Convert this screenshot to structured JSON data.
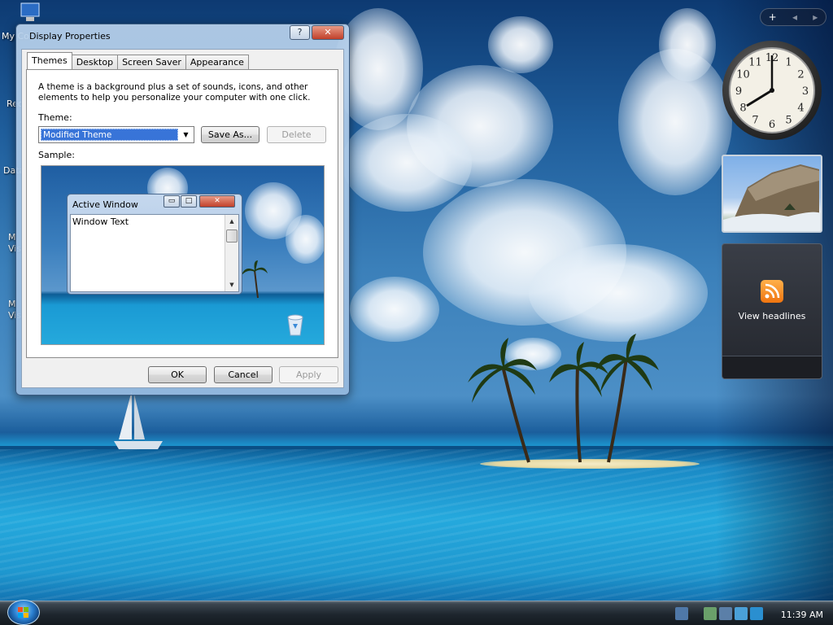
{
  "desktop": {
    "icons": [
      {
        "label": "My Co",
        "icon": "computer-icon"
      },
      {
        "label": "Rec",
        "icon": "recycle-bin-icon"
      },
      {
        "label": "Data",
        "icon": "folder-icon"
      },
      {
        "label": "M\nVis",
        "icon": "application-icon"
      },
      {
        "label": "M\nVis",
        "icon": "application-icon"
      }
    ]
  },
  "sidebar": {
    "controls": [
      "+",
      "◂",
      "▸"
    ],
    "feed_label": "View headlines",
    "clock_numerals": [
      "12",
      "1",
      "2",
      "3",
      "4",
      "5",
      "6",
      "7",
      "8",
      "9",
      "10",
      "11"
    ]
  },
  "dialog": {
    "title": "Display Properties",
    "help_label": "?",
    "close_label": "✕",
    "tabs": [
      "Themes",
      "Desktop",
      "Screen Saver",
      "Appearance"
    ],
    "description": "A theme is a background plus a set of sounds, icons, and other elements to help you personalize your computer with one click.",
    "theme_label": "Theme:",
    "theme_value": "Modified Theme",
    "save_as_label": "Save As...",
    "delete_label": "Delete",
    "sample_label": "Sample:",
    "sample": {
      "title": "Active Window",
      "body_text": "Window Text"
    },
    "ok_label": "OK",
    "cancel_label": "Cancel",
    "apply_label": "Apply"
  },
  "taskbar": {
    "time": "11:39 AM"
  },
  "colors": {
    "accent": "#3874d8",
    "title_bar": "#b9d2ec",
    "close_button": "#c1402a"
  }
}
